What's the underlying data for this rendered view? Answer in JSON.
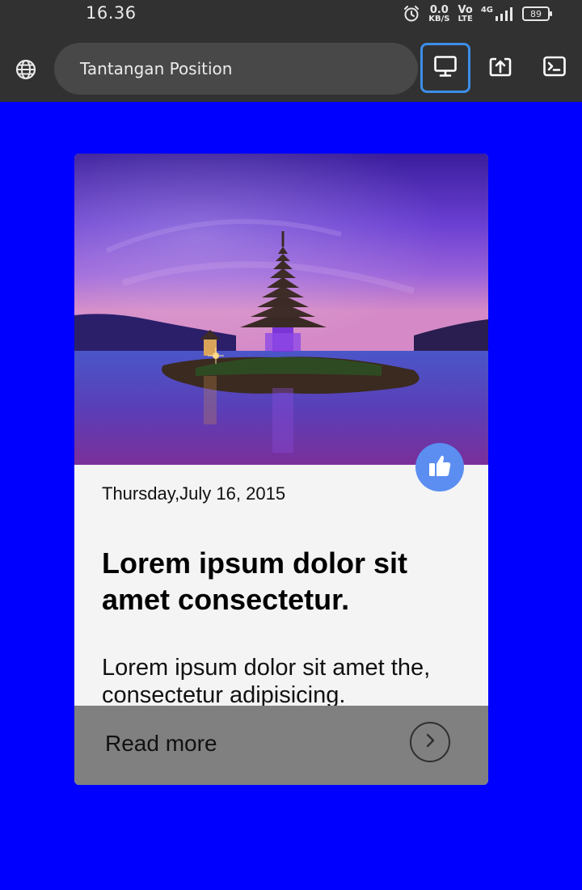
{
  "status_bar": {
    "time": "16.36",
    "net_speed_value": "0.0",
    "net_speed_unit": "KB/S",
    "volte_top": "Vo",
    "volte_bottom": "LTE",
    "network": "4G",
    "battery": "89"
  },
  "browser": {
    "title": "Tantangan Position",
    "icons": [
      "globe-icon",
      "desktop-view-icon",
      "open-in-app-icon",
      "terminal-icon"
    ]
  },
  "card": {
    "date": "Thursday,July 16, 2015",
    "title": "Lorem ipsum dolor sit amet consectetur.",
    "excerpt": "Lorem ipsum dolor sit amet the, consectetur adipisicing.",
    "read_more": "Read more",
    "icons": [
      "thumbs-up-icon",
      "chevron-right-icon"
    ]
  },
  "colors": {
    "page_background": "#0000ff",
    "bar_background": "#313131",
    "card_background": "#f4f4f4",
    "footer_background": "#808080",
    "like_button": "#5b8ef0",
    "active_button_border": "#3d8ee8"
  }
}
